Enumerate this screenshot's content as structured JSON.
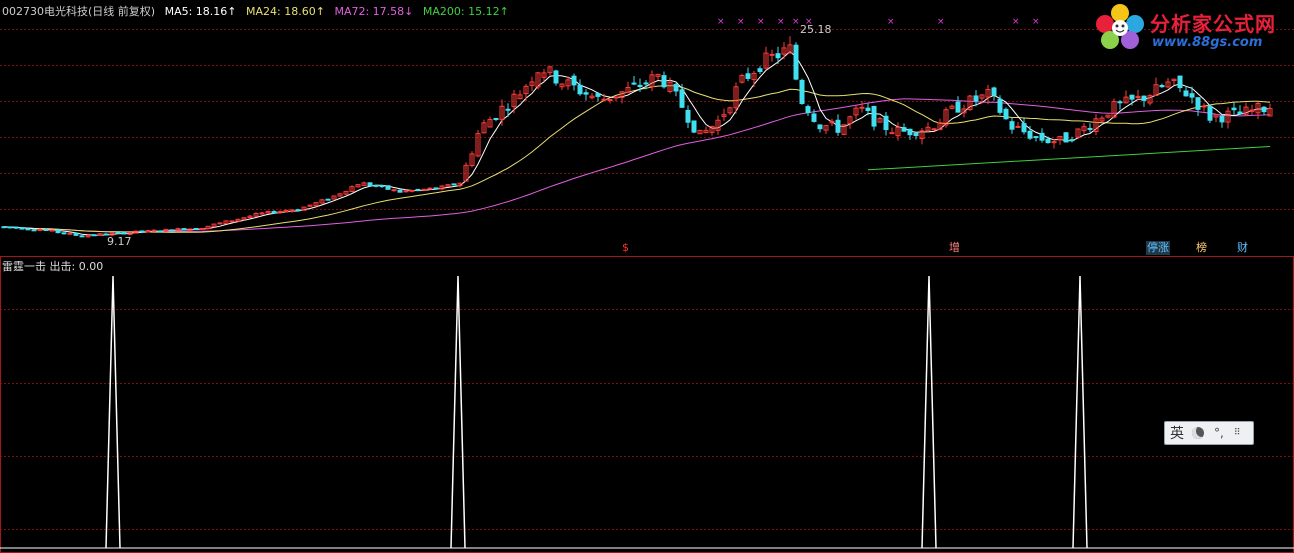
{
  "header": {
    "code": "002730",
    "name": "电光科技(日线 前复权)",
    "ma": [
      {
        "label": "MA5: 18.16↑",
        "color": "#ffffff"
      },
      {
        "label": "MA24: 18.60↑",
        "color": "#e8e070"
      },
      {
        "label": "MA72: 17.58↓",
        "color": "#e060e0"
      },
      {
        "label": "MA200: 15.12↑",
        "color": "#40d040"
      }
    ]
  },
  "indicator_header": "雷霆一击 出击: 0.00",
  "logo": {
    "text": "分析家公式网",
    "url": "www.88gs.com"
  },
  "ime_bar": {
    "lang": "英",
    "icons": [
      "moon-icon",
      "punctuation-icon",
      "grid-icon"
    ]
  },
  "badges": [
    {
      "label": "$",
      "color": "#ff3030"
    },
    {
      "label": "增",
      "color": "#ff8080"
    },
    {
      "label": "停涨",
      "color": "#60c0ff"
    },
    {
      "label": "榜",
      "color": "#ffd070"
    },
    {
      "label": "财",
      "color": "#60c0ff"
    }
  ],
  "colors": {
    "up": "#ff3a3a",
    "down": "#40e0f0",
    "grid": "#7a1010",
    "ma5": "#ffffff",
    "ma24": "#e8e070",
    "ma72": "#e060e0",
    "ma200": "#40d040"
  },
  "chart_data": [
    {
      "type": "candlestick",
      "title": "002730 电光科技(日线 前复权)",
      "annotations": [
        {
          "label": "25.18",
          "meaning": "period high"
        },
        {
          "label": "9.17",
          "meaning": "period low"
        }
      ],
      "series": [
        {
          "name": "MA5",
          "last": 18.16
        },
        {
          "name": "MA24",
          "last": 18.6
        },
        {
          "name": "MA72",
          "last": 17.58
        },
        {
          "name": "MA200",
          "last": 15.12
        }
      ],
      "ylim": [
        9.17,
        25.18
      ]
    },
    {
      "type": "line",
      "title": "雷霆一击 出击: 0.00",
      "spikes": 4,
      "ylim": [
        0,
        1
      ]
    }
  ]
}
